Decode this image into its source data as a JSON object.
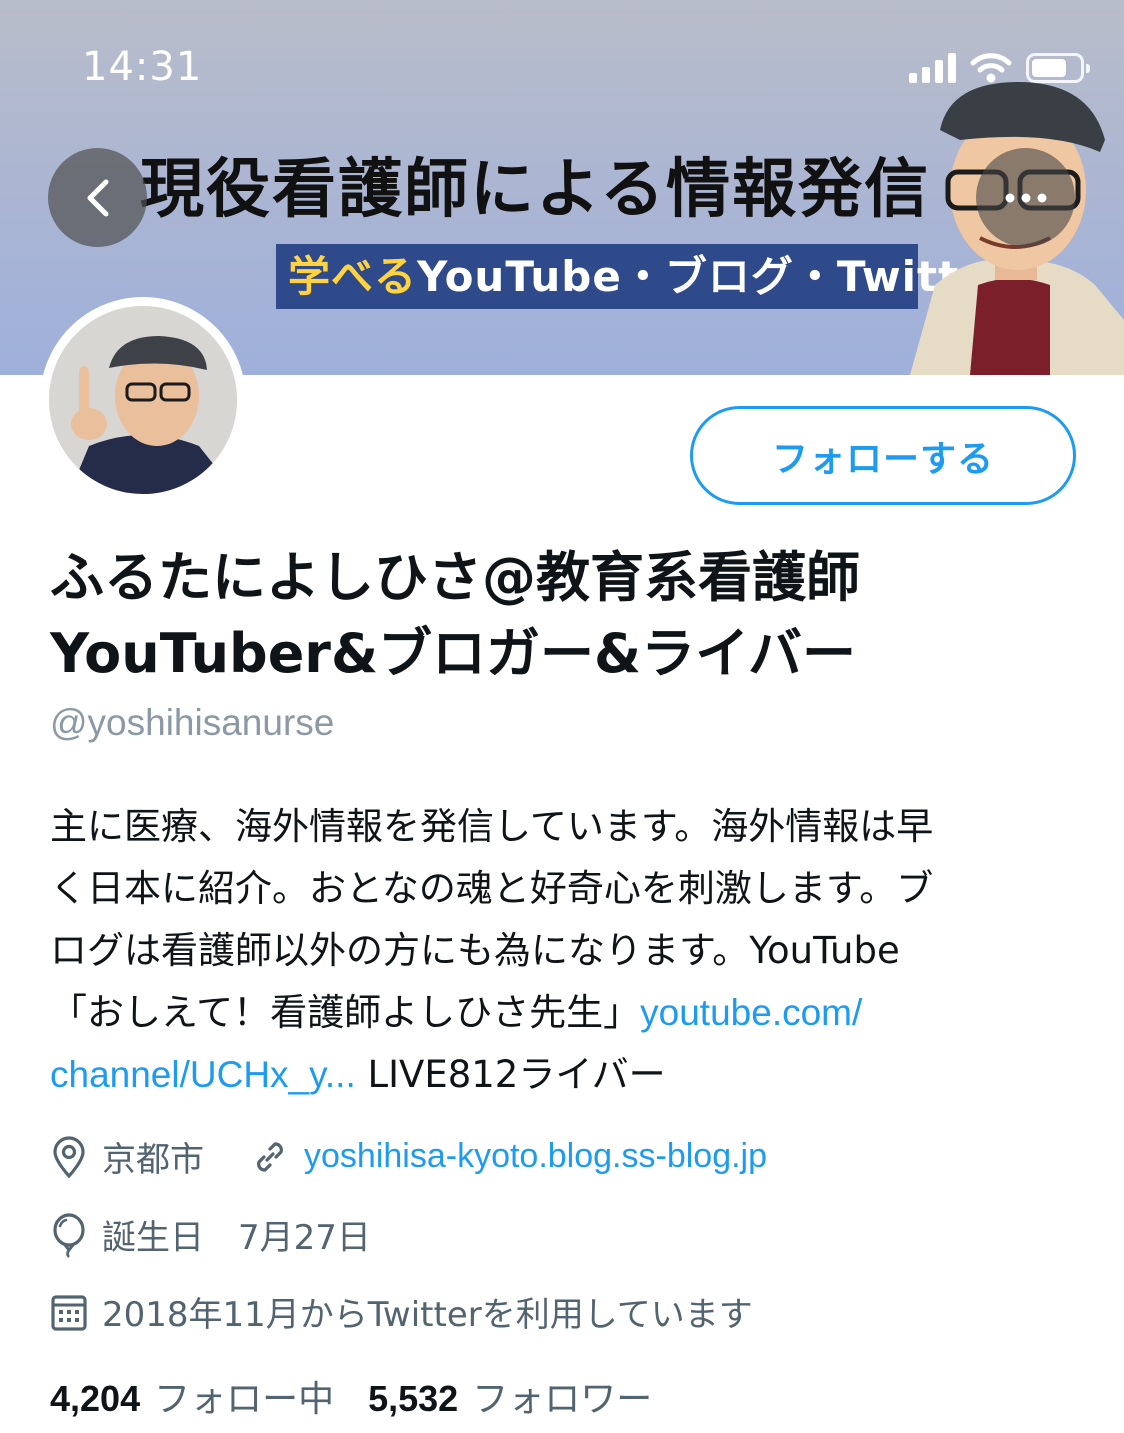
{
  "status_bar": {
    "time": "14:31"
  },
  "banner": {
    "title": "現役看護師による情報発信",
    "subtitle_highlight": "学べる",
    "subtitle_rest": "YouTube・ブログ・Twitter"
  },
  "actions": {
    "follow_label": "フォローする"
  },
  "profile": {
    "name_line1": "ふるたによしひさ@教育系看護師",
    "name_line2": "YouTuber&ブロガー&ライバー",
    "handle": "@yoshihisanurse",
    "bio": {
      "line1": "主に医療、海外情報を発信しています。海外情報は早",
      "line2": "く日本に紹介。おとなの魂と好奇心を刺激します。ブ",
      "line3": "ログは看護師以外の方にも為になります。YouTube",
      "line4_text": "「おしえて！看護師よしひさ先生」",
      "link_part1": "youtube.com/",
      "link_part2": "channel/UCHx_y...",
      "line5_text": " LIVE812ライバー"
    },
    "location": "京都市",
    "website": "yoshihisa-kyoto.blog.ss-blog.jp",
    "birthday": "誕生日　7月27日",
    "joined": "2018年11月からTwitterを利用しています"
  },
  "stats": {
    "following_count": "4,204",
    "following_label": "フォロー中",
    "followers_count": "5,532",
    "followers_label": "フォロワー"
  },
  "colors": {
    "accent": "#1d9bf0",
    "secondary_text": "#536471",
    "banner_bar": "#2f4a8a"
  }
}
